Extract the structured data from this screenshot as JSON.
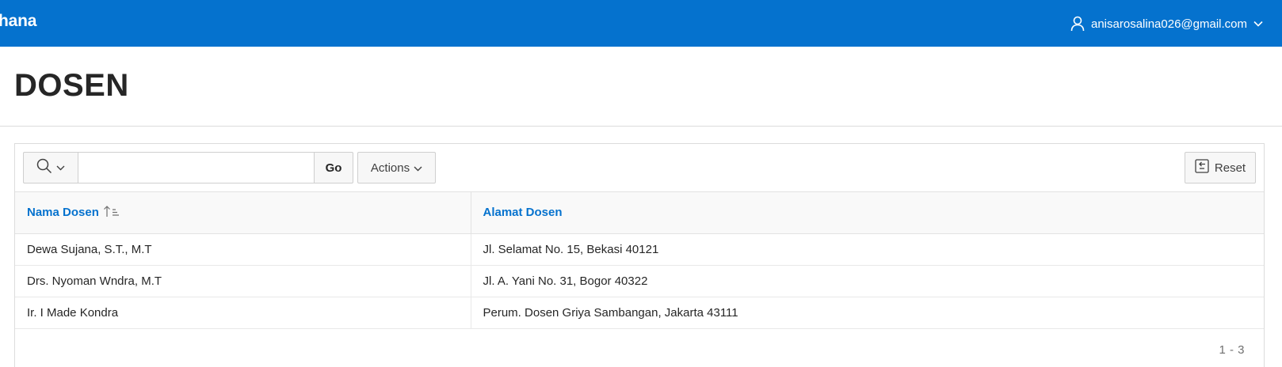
{
  "header": {
    "app_title": "rhana",
    "user_email": "anisarosalina026@gmail.com"
  },
  "page": {
    "title": "DOSEN"
  },
  "toolbar": {
    "search_value": "",
    "go_label": "Go",
    "actions_label": "Actions",
    "reset_label": "Reset"
  },
  "table": {
    "columns": [
      "Nama Dosen",
      "Alamat Dosen"
    ],
    "sorted_column": "Nama Dosen",
    "sort_direction": "ascending",
    "rows": [
      [
        "Dewa Sujana, S.T., M.T",
        "Jl. Selamat No. 15, Bekasi 40121"
      ],
      [
        "Drs. Nyoman Wndra, M.T",
        "Jl. A. Yani No. 31, Bogor 40322"
      ],
      [
        "Ir. I Made Kondra",
        "Perum. Dosen Griya Sambangan, Jakarta 43111"
      ]
    ]
  },
  "pagination": {
    "range": "1 - 3"
  },
  "colors": {
    "header_bg": "#0572ce",
    "link": "#0572ce"
  },
  "icons": {
    "search": "search-icon",
    "chevron": "chevron-down-icon",
    "user": "user-icon",
    "reset": "reset-icon",
    "sort": "sort-ascending-icon"
  }
}
